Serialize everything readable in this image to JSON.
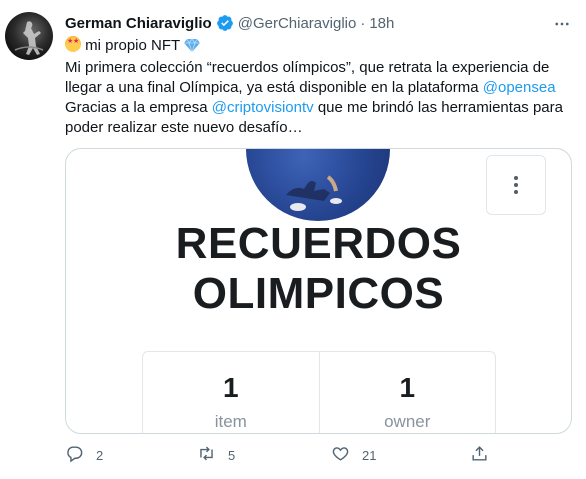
{
  "tweet": {
    "author_name": "German Chiaraviglio",
    "handle": "@GerChiaraviglio",
    "separator": "·",
    "time": "18h",
    "text": {
      "line1_text": " mi propio NFT ",
      "line2": "Mi primera colección “recuerdos olímpicos”, que retrata la experiencia de",
      "line3_text": "llegar a una final Olímpica, ya está disponible en la plataforma ",
      "line3_mention": "@opensea",
      "line4_pre": " Gracias a la empresa ",
      "line4_mention": "@criptovisiontv",
      "line4_post": " que me brindó las herramientas para",
      "line5": "poder realizar este nuevo desafío…"
    },
    "card": {
      "title_line1": "RECUERDOS",
      "title_line2": "OLIMPICOS",
      "stats": [
        {
          "value": "1",
          "label": "item"
        },
        {
          "value": "1",
          "label": "owner"
        }
      ]
    },
    "actions": {
      "replies": "2",
      "retweets": "5",
      "likes": "21"
    }
  },
  "colors": {
    "accent": "#1d9bf0",
    "secondary_text": "#536471",
    "card_border": "#cfd9de"
  },
  "icons": [
    "avatar",
    "verified-badge-icon",
    "more-icon",
    "star-struck-emoji",
    "gem-emoji",
    "kebab-menu-icon",
    "reply-icon",
    "retweet-icon",
    "like-icon",
    "share-icon"
  ]
}
